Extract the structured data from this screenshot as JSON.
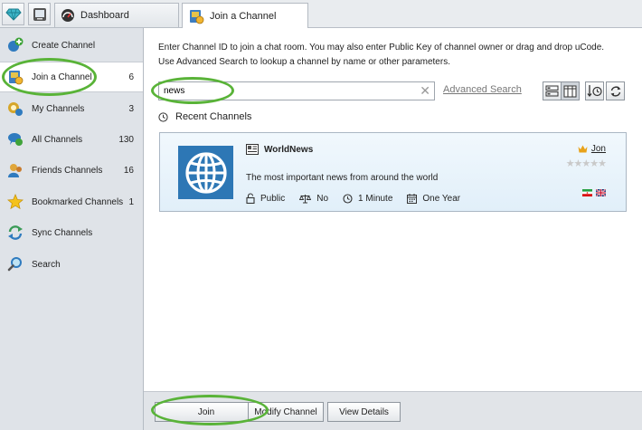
{
  "tabs": [
    {
      "label": "Dashboard",
      "icon": "gauge-icon"
    },
    {
      "label": "Join a Channel",
      "icon": "join-channel-icon"
    }
  ],
  "sidebar": {
    "items": [
      {
        "label": "Create Channel",
        "count": "",
        "icon": "create-channel-icon"
      },
      {
        "label": "Join a Channel",
        "count": "6",
        "icon": "join-channel-icon"
      },
      {
        "label": "My Channels",
        "count": "3",
        "icon": "my-channels-icon"
      },
      {
        "label": "All Channels",
        "count": "130",
        "icon": "all-channels-icon"
      },
      {
        "label": "Friends Channels",
        "count": "16",
        "icon": "friends-channels-icon"
      },
      {
        "label": "Bookmarked Channels",
        "count": "1",
        "icon": "star-icon"
      },
      {
        "label": "Sync Channels",
        "count": "",
        "icon": "sync-icon"
      },
      {
        "label": "Search",
        "count": "",
        "icon": "magnifier-icon"
      }
    ]
  },
  "main": {
    "instruction_line1": "Enter Channel ID to join a chat room. You may also enter Public Key of channel owner or drag and drop uCode.",
    "instruction_line2": "Use Advanced Search to lookup a channel by name or other parameters.",
    "search_value": "news",
    "clear_symbol": "✕",
    "advanced_search_label": "Advanced Search",
    "recent_title": "Recent Channels",
    "channel": {
      "name": "WorldNews",
      "description": "The most important news from around the world",
      "owner": "Jon",
      "stars": "★★★★★",
      "visibility": "Public",
      "moderated": "No",
      "interval": "1 Minute",
      "retention": "One Year"
    }
  },
  "bottom": {
    "join_label": "Join",
    "modify_label": "Modify Channel",
    "details_label": "View Details"
  },
  "colors": {
    "accent_green": "#59b338",
    "globe_blue": "#2d77b5",
    "crown_gold": "#e8a21a"
  }
}
